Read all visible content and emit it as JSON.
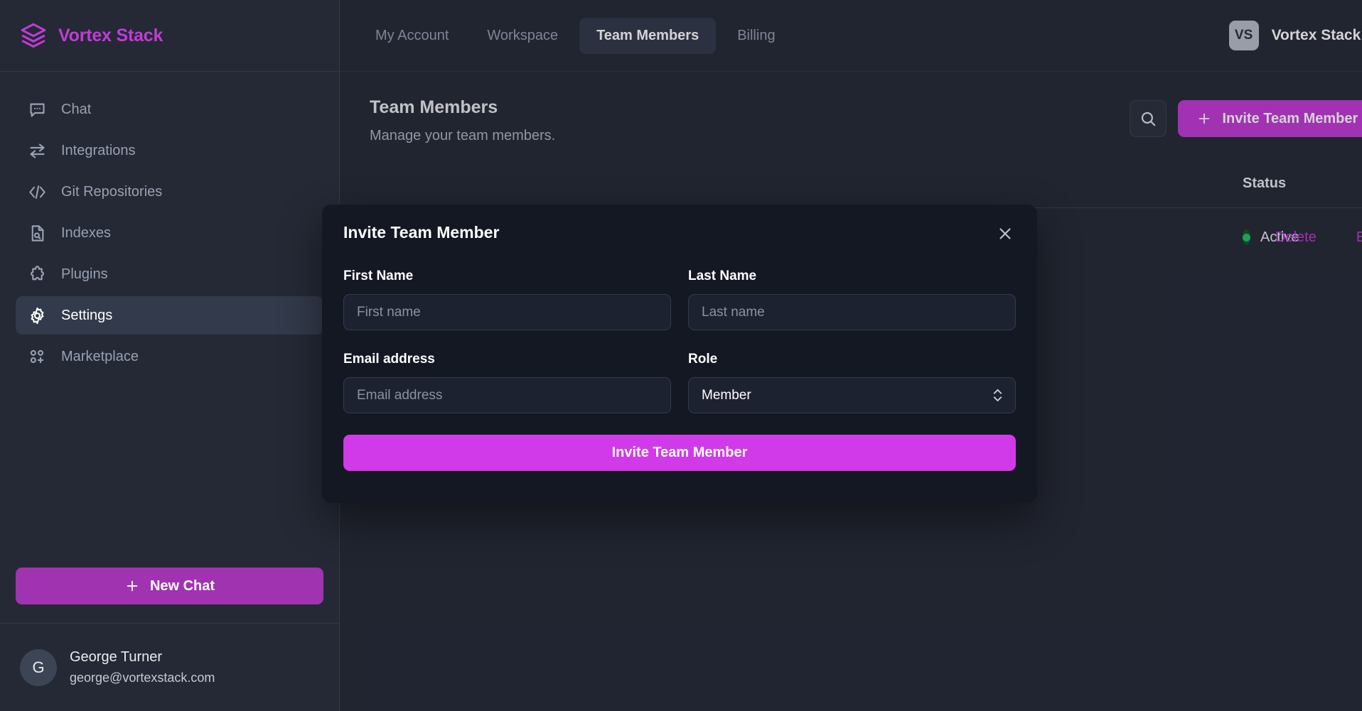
{
  "brand": {
    "name": "Vortex Stack",
    "logo_icon": "layers-stack-icon"
  },
  "sidebar": {
    "items": [
      {
        "label": "Chat",
        "icon": "chat-bubble-icon",
        "active": false
      },
      {
        "label": "Integrations",
        "icon": "swap-arrows-icon",
        "active": false
      },
      {
        "label": "Git Repositories",
        "icon": "code-brackets-icon",
        "active": false
      },
      {
        "label": "Indexes",
        "icon": "document-search-icon",
        "active": false
      },
      {
        "label": "Plugins",
        "icon": "puzzle-piece-icon",
        "active": false
      },
      {
        "label": "Settings",
        "icon": "gear-icon",
        "active": true
      },
      {
        "label": "Marketplace",
        "icon": "grid-plus-icon",
        "active": false
      }
    ],
    "new_chat_label": "New Chat",
    "profile": {
      "initial": "G",
      "name": "George Turner",
      "email": "george@vortexstack.com"
    }
  },
  "topbar": {
    "tabs": [
      {
        "label": "My Account",
        "active": false
      },
      {
        "label": "Workspace",
        "active": false
      },
      {
        "label": "Team Members",
        "active": true
      },
      {
        "label": "Billing",
        "active": false
      }
    ],
    "workspace": {
      "initials": "VS",
      "name": "Vortex Stack"
    }
  },
  "page": {
    "title": "Team Members",
    "subtitle": "Manage your team members.",
    "search_icon": "search-icon",
    "invite_label": "Invite Team Member"
  },
  "table": {
    "status_header": "Status",
    "rows": [
      {
        "status": "Active",
        "delete_label": "Delete",
        "edit_label": "Edit"
      }
    ]
  },
  "modal": {
    "title": "Invite Team Member",
    "close_icon": "close-icon",
    "first_name": {
      "label": "First Name",
      "value": "",
      "placeholder": "First name"
    },
    "last_name": {
      "label": "Last Name",
      "value": "",
      "placeholder": "Last name"
    },
    "email": {
      "label": "Email address",
      "value": "",
      "placeholder": "Email address"
    },
    "role": {
      "label": "Role",
      "selected": "Member"
    },
    "submit_label": "Invite Team Member"
  },
  "colors": {
    "brand_purple": "#C23BD6",
    "new_chat_purple": "#A033B0",
    "modal_submit_magenta": "#D13AE8",
    "status_green": "#22C55E",
    "sidebar_bg": "#242935",
    "main_bg": "#262B38",
    "modal_bg": "#141823"
  }
}
